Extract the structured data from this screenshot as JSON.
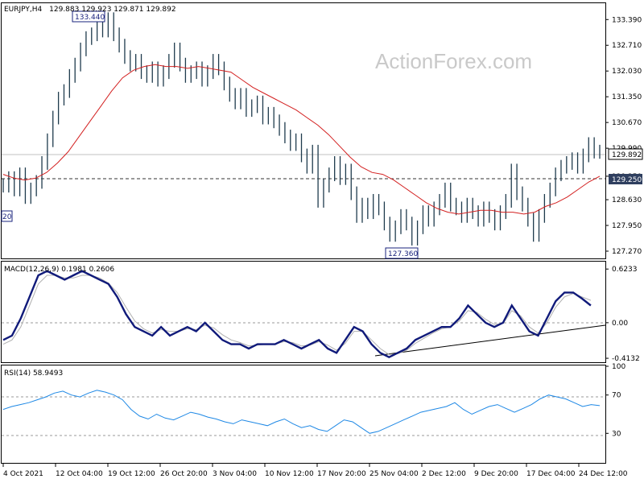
{
  "watermark": "ActionForex.com",
  "chart_data": [
    {
      "type": "line",
      "panel": "price",
      "title": "EURJPY,H4",
      "ohlc_text": "129.883 129.923 129.871 129.892",
      "y_ticks": [
        "133.390",
        "132.710",
        "132.030",
        "131.350",
        "130.670",
        "129.990",
        "129.250",
        "128.630",
        "127.950",
        "127.270"
      ],
      "ylim": [
        127.1,
        133.8
      ],
      "last_price": "129.892",
      "support_level": "129.250",
      "annotations": [
        "133.440",
        "127.360",
        "20"
      ],
      "x_labels": [
        "4 Oct 2021",
        "12 Oct 04:00",
        "19 Oct 12:00",
        "26 Oct 20:00",
        "3 Nov 04:00",
        "10 Nov 12:00",
        "17 Nov 20:00",
        "25 Nov 04:00",
        "2 Dec 12:00",
        "9 Dec 20:00",
        "17 Dec 04:00",
        "24 Dec 12:00"
      ],
      "series": [
        {
          "name": "price",
          "values": [
            129.0,
            129.2,
            128.9,
            129.3,
            128.7,
            128.9,
            129.1,
            129.6,
            130.2,
            130.8,
            131.3,
            131.5,
            131.9,
            132.2,
            132.6,
            132.9,
            133.0,
            133.2,
            133.1,
            133.4,
            133.0,
            132.7,
            132.4,
            132.2,
            132.3,
            132.0,
            131.9,
            132.1,
            131.8,
            132.0,
            132.3,
            132.6,
            132.2,
            131.9,
            132.0,
            132.1,
            131.8,
            132.0,
            132.3,
            132.1,
            131.7,
            131.4,
            131.2,
            131.4,
            131.0,
            131.1,
            131.2,
            130.8,
            130.9,
            130.7,
            130.5,
            130.3,
            130.1,
            130.2,
            129.8,
            129.5,
            129.9,
            128.6,
            129.0,
            129.3,
            129.6,
            129.2,
            129.4,
            128.8,
            128.2,
            128.5,
            128.3,
            128.6,
            128.4,
            128.0,
            127.7,
            127.9,
            128.2,
            128.0,
            127.6,
            127.9,
            128.3,
            128.1,
            128.4,
            128.6,
            128.9,
            128.5,
            128.4,
            128.2,
            128.5,
            128.3,
            128.1,
            128.4,
            128.2,
            128.0,
            128.3,
            128.6,
            129.4,
            128.8,
            128.5,
            128.1,
            127.7,
            128.2,
            128.6,
            128.9,
            129.3,
            129.5,
            129.6,
            129.7,
            129.5,
            129.8,
            130.1,
            129.9,
            129.892
          ]
        },
        {
          "name": "ma",
          "values": [
            129.3,
            129.2,
            129.15,
            129.2,
            129.35,
            129.6,
            129.9,
            130.3,
            130.7,
            131.1,
            131.5,
            131.85,
            132.05,
            132.15,
            132.2,
            132.15,
            132.15,
            132.1,
            132.15,
            132.1,
            132.05,
            132.0,
            131.8,
            131.6,
            131.45,
            131.3,
            131.15,
            131.0,
            130.8,
            130.6,
            130.35,
            130.05,
            129.75,
            129.5,
            129.35,
            129.3,
            129.15,
            128.95,
            128.75,
            128.55,
            128.4,
            128.3,
            128.25,
            128.3,
            128.35,
            128.35,
            128.3,
            128.3,
            128.25,
            128.3,
            128.45,
            128.55,
            128.7,
            128.9,
            129.1,
            129.25
          ]
        }
      ]
    },
    {
      "type": "line",
      "panel": "macd",
      "title": "MACD(12,26,9) 0.1981 0.2606",
      "y_ticks": [
        "0.6233",
        "0.00",
        "-0.4132"
      ],
      "ylim": [
        -0.45,
        0.7
      ],
      "series": [
        {
          "name": "macd",
          "values": [
            -0.2,
            -0.15,
            0.05,
            0.3,
            0.55,
            0.6,
            0.55,
            0.5,
            0.55,
            0.6,
            0.55,
            0.5,
            0.45,
            0.3,
            0.1,
            -0.05,
            -0.1,
            -0.15,
            -0.05,
            -0.15,
            -0.1,
            -0.05,
            -0.1,
            0.0,
            -0.1,
            -0.2,
            -0.25,
            -0.25,
            -0.3,
            -0.25,
            -0.25,
            -0.25,
            -0.2,
            -0.25,
            -0.3,
            -0.25,
            -0.2,
            -0.3,
            -0.35,
            -0.2,
            -0.05,
            -0.1,
            -0.25,
            -0.35,
            -0.4,
            -0.35,
            -0.3,
            -0.2,
            -0.15,
            -0.1,
            -0.05,
            -0.05,
            0.05,
            0.2,
            0.1,
            0.0,
            -0.05,
            0.0,
            0.2,
            0.05,
            -0.1,
            -0.15,
            0.05,
            0.25,
            0.35,
            0.35,
            0.28,
            0.2
          ],
          "x_end_fraction": 0.985
        },
        {
          "name": "signal",
          "values": [
            -0.25,
            -0.2,
            -0.05,
            0.2,
            0.45,
            0.55,
            0.55,
            0.52,
            0.52,
            0.55,
            0.55,
            0.52,
            0.46,
            0.35,
            0.18,
            0.02,
            -0.07,
            -0.12,
            -0.08,
            -0.1,
            -0.1,
            -0.07,
            -0.08,
            -0.03,
            -0.06,
            -0.14,
            -0.2,
            -0.23,
            -0.27,
            -0.26,
            -0.25,
            -0.25,
            -0.22,
            -0.23,
            -0.27,
            -0.26,
            -0.22,
            -0.26,
            -0.32,
            -0.24,
            -0.1,
            -0.1,
            -0.2,
            -0.3,
            -0.37,
            -0.36,
            -0.32,
            -0.24,
            -0.18,
            -0.12,
            -0.07,
            -0.05,
            0.02,
            0.14,
            0.12,
            0.04,
            -0.02,
            -0.01,
            0.14,
            0.08,
            -0.05,
            -0.12,
            0.0,
            0.18,
            0.3,
            0.34,
            0.3,
            0.26
          ],
          "x_end_fraction": 0.985
        }
      ]
    },
    {
      "type": "line",
      "panel": "rsi",
      "title": "RSI(14) 58.9493",
      "y_ticks": [
        "100",
        "70",
        "30"
      ],
      "ylim": [
        0,
        100
      ],
      "series": [
        {
          "name": "rsi",
          "values": [
            55,
            58,
            60,
            62,
            65,
            68,
            72,
            74,
            70,
            68,
            72,
            75,
            73,
            70,
            65,
            55,
            48,
            45,
            50,
            46,
            44,
            48,
            52,
            50,
            47,
            45,
            42,
            40,
            44,
            42,
            40,
            38,
            42,
            45,
            40,
            36,
            38,
            34,
            32,
            38,
            44,
            42,
            36,
            30,
            32,
            36,
            40,
            44,
            48,
            52,
            54,
            56,
            58,
            62,
            55,
            50,
            54,
            58,
            60,
            56,
            52,
            56,
            60,
            66,
            70,
            68,
            66,
            62,
            58,
            60,
            58.9
          ]
        }
      ]
    }
  ]
}
